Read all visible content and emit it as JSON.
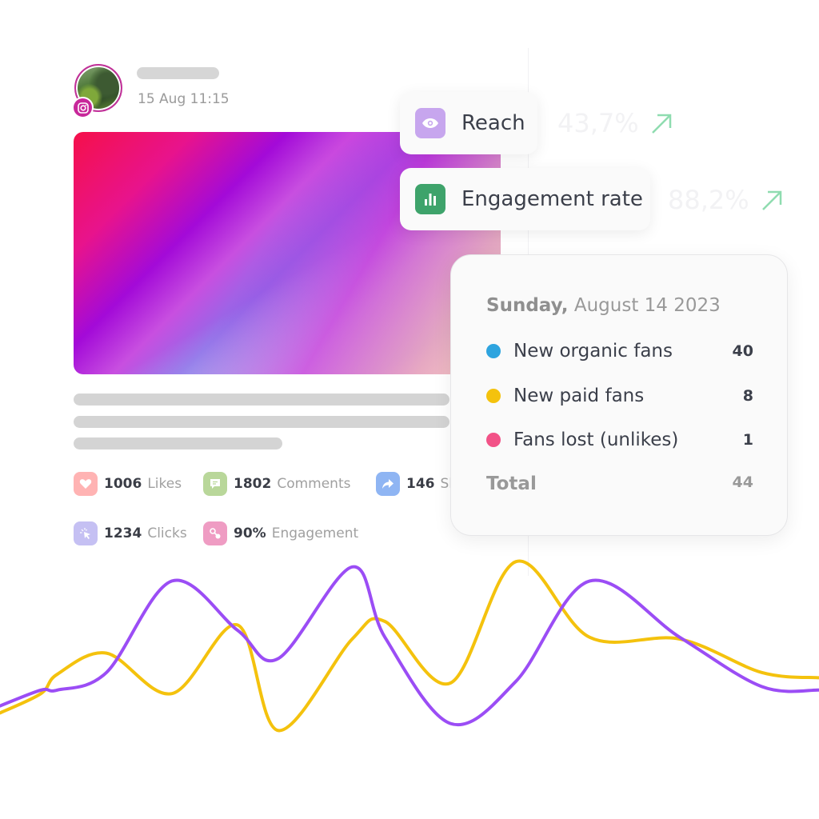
{
  "post": {
    "platform": "instagram",
    "timestamp": "15 Aug 11:15",
    "stats": [
      {
        "icon": "heart-icon",
        "value": "1006",
        "label": "Likes",
        "color": "#ffb3b3"
      },
      {
        "icon": "comment-icon",
        "value": "1802",
        "label": "Comments",
        "color": "#b9d79a"
      },
      {
        "icon": "share-icon",
        "value": "146",
        "label": "Sl",
        "color": "#8fb5f3"
      },
      {
        "icon": "click-icon",
        "value": "1234",
        "label": "Clicks",
        "color": "#c5c0f3"
      },
      {
        "icon": "engagement-icon",
        "value": "90%",
        "label": "Engagement",
        "color": "#ef9cc3"
      }
    ]
  },
  "metrics": [
    {
      "icon": "eye-icon",
      "label": "Reach",
      "value": "43,7%",
      "icon_color": "#c7a6ee",
      "trend": "up"
    },
    {
      "icon": "bar-chart-icon",
      "label": "Engagement rate",
      "value": "88,2%",
      "icon_color": "#3ea36b",
      "trend": "up"
    }
  ],
  "tooltip": {
    "day": "Sunday,",
    "date": "August 14  2023",
    "rows": [
      {
        "label": "New organic fans",
        "value": "40",
        "color": "#2ea4df"
      },
      {
        "label": "New paid fans",
        "value": "8",
        "color": "#f4c20d"
      },
      {
        "label": "Fans lost (unlikes)",
        "value": "1",
        "color": "#f25287"
      }
    ],
    "total_label": "Total",
    "total_value": "44"
  },
  "colors": {
    "trend_arrow": "#8fdcb0",
    "instagram": "#c8279a"
  },
  "chart_data": {
    "type": "line",
    "title": "",
    "xlabel": "",
    "ylabel": "",
    "x": [
      0,
      5,
      7,
      13,
      21,
      29,
      34,
      43,
      47,
      55,
      63,
      72,
      83,
      93,
      100
    ],
    "ylim": [
      0,
      100
    ],
    "grid": false,
    "legend": "none",
    "series": [
      {
        "name": "purple",
        "color": "#9b4df5",
        "values": [
          17,
          26,
          26,
          36,
          88,
          60,
          44,
          96,
          56,
          7,
          31,
          88,
          56,
          28,
          26
        ]
      },
      {
        "name": "yellow",
        "color": "#f4c20d",
        "values": [
          13,
          24,
          35,
          47,
          24,
          63,
          3,
          55,
          65,
          30,
          99,
          56,
          55,
          36,
          33
        ]
      }
    ]
  }
}
